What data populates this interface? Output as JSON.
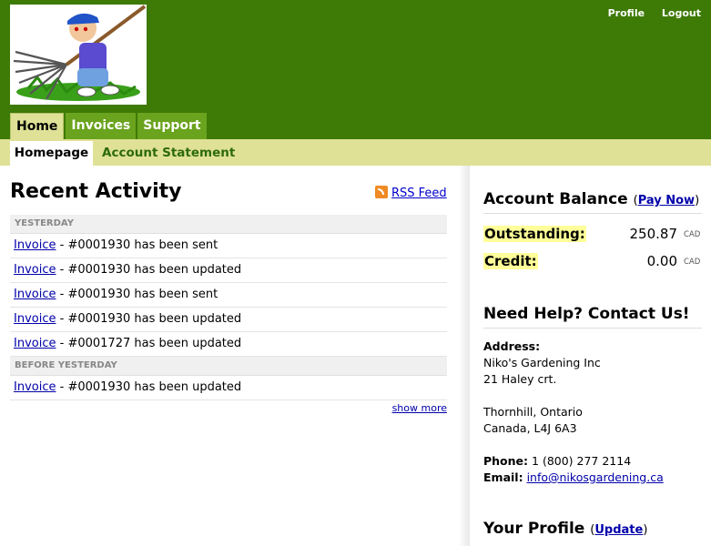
{
  "header": {
    "links": [
      "Profile",
      "Logout"
    ],
    "tabs": [
      "Home",
      "Invoices",
      "Support"
    ],
    "subtabs": [
      "Homepage",
      "Account Statement"
    ]
  },
  "activity": {
    "title": "Recent Activity",
    "rss_label": "RSS Feed",
    "sections": [
      {
        "label": "YESTERDAY",
        "rows": [
          {
            "link": "Invoice",
            "text": " - #0001930 has been sent"
          },
          {
            "link": "Invoice",
            "text": " - #0001930 has been updated"
          },
          {
            "link": "Invoice",
            "text": " - #0001930 has been sent"
          },
          {
            "link": "Invoice",
            "text": " - #0001930 has been updated"
          },
          {
            "link": "Invoice",
            "text": " - #0001727 has been updated"
          }
        ]
      },
      {
        "label": "BEFORE YESTERDAY",
        "rows": [
          {
            "link": "Invoice",
            "text": " - #0001930 has been updated"
          }
        ]
      }
    ],
    "show_more": "show more"
  },
  "balance": {
    "title": "Account Balance",
    "pay_now": "Pay Now",
    "outstanding_label": "Outstanding:",
    "outstanding_value": "250.87",
    "credit_label": "Credit:",
    "credit_value": "0.00",
    "currency": "CAD"
  },
  "help": {
    "title": "Need Help? Contact Us!",
    "address_label": "Address:",
    "address_lines": [
      "Niko's Gardening Inc",
      "21 Haley crt.",
      "",
      "Thornhill, Ontario",
      "Canada, L4J 6A3"
    ],
    "phone_label": "Phone:",
    "phone": "1 (800) 277 2114",
    "email_label": "Email:",
    "email": "info@nikosgardening.ca"
  },
  "profile": {
    "title": "Your Profile",
    "update": "Update"
  }
}
